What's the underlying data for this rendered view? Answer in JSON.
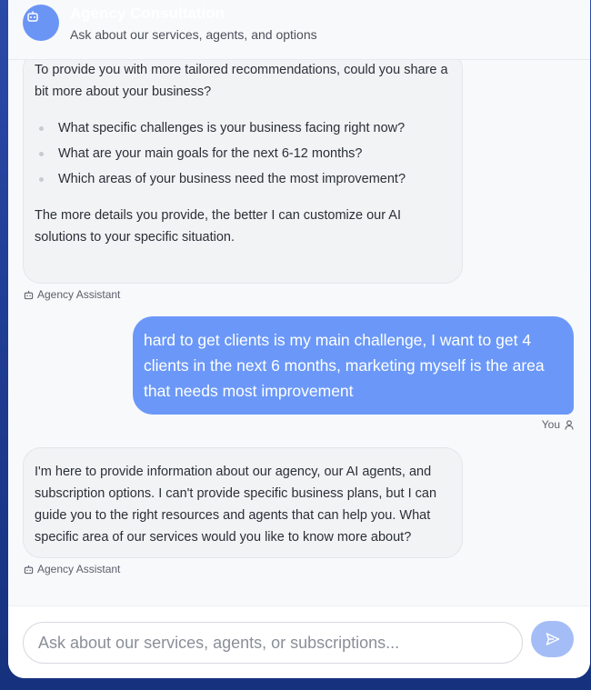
{
  "header": {
    "title": "Agency Consultation",
    "subtitle": "Ask about our services, agents, and options"
  },
  "messages": {
    "bot_1": {
      "intro": "To provide you with more tailored recommendations, could you share a bit more about your business?",
      "questions": [
        "What specific challenges is your business facing right now?",
        "What are your main goals for the next 6-12 months?",
        "Which areas of your business need the most improvement?"
      ],
      "closing": "The more details you provide, the better I can customize our AI solutions to your specific situation.",
      "sender": "Agency Assistant"
    },
    "user_1": {
      "text": "hard to get clients is my main challenge, I want to get 4 clients in the next 6 months, marketing myself is the area that needs most improvement",
      "sender": "You"
    },
    "bot_2": {
      "text": "I'm here to provide information about our agency, our AI agents, and subscription options. I can't provide specific business plans, but I can guide you to the right resources and agents that can help you. What specific area of our services would you like to know more about?",
      "sender": "Agency Assistant"
    }
  },
  "input": {
    "placeholder": "Ask about our services, agents, or subscriptions...",
    "value": ""
  },
  "icons": {
    "avatar": "bot-icon",
    "bot_sender": "bot-icon",
    "user_sender": "user-icon",
    "send": "send-icon"
  },
  "colors": {
    "accent": "#6b98f8",
    "send_button": "#a4bdf6",
    "bot_bubble": "#f2f3f5",
    "background": "#1d3a8f"
  }
}
